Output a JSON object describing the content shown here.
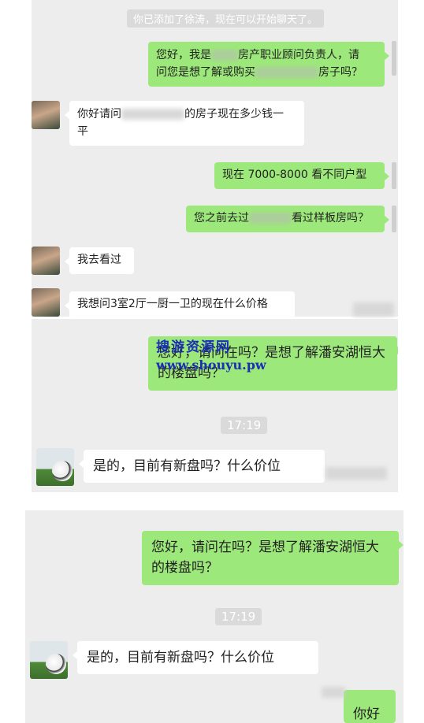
{
  "panel1": {
    "system_notice": "你已添加了徐涛，现在可以开始聊天了。",
    "msg1_part1": "您好，我是",
    "msg1_part2": "房产职业顾问负责人，请",
    "msg1_part3": "问您是想了解或购买",
    "msg1_part4": "房子吗？",
    "msg2_part1": "你好请问",
    "msg2_part2": "的房子现在多少钱一",
    "msg2_part3": "平",
    "msg3": "现在 7000-8000 看不同户型",
    "msg4_part1": "您之前去过",
    "msg4_part2": "看过样板房吗？",
    "msg5": "我去看过",
    "msg6": "我想问3室2厅一厨一卫的现在什么价格"
  },
  "panel2": {
    "msg1": "您好，请问在吗？是想了解潘安湖恒大的楼盘吗？",
    "time": "17:19",
    "msg2": "是的，目前有新盘吗？什么价位"
  },
  "watermark": {
    "line1": "搜游资源网",
    "line2": "www.shouyu.pw"
  },
  "panel3": {
    "msg1": "您好，请问在吗？是想了解潘安湖恒大的楼盘吗？",
    "time": "17:19",
    "msg2": "是的，目前有新盘吗？什么价位",
    "partial_bubble": "你好"
  },
  "colors": {
    "chat_bg": "#ededed",
    "outgoing_bubble": "#9de87a",
    "incoming_bubble": "#ffffff",
    "watermark": "#1a2fb4"
  }
}
